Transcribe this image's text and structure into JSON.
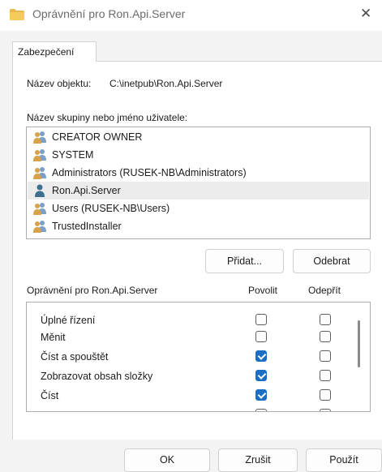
{
  "window": {
    "title": "Oprávnění pro Ron.Api.Server",
    "close_glyph": "✕"
  },
  "tab": {
    "label": "Zabezpečení"
  },
  "object": {
    "label": "Název objektu:",
    "value": "C:\\inetpub\\Ron.Api.Server"
  },
  "groups": {
    "label": "Název skupiny nebo jméno uživatele:",
    "items": [
      {
        "name": "CREATOR OWNER",
        "icon": "group-icon"
      },
      {
        "name": "SYSTEM",
        "icon": "group-icon"
      },
      {
        "name": "Administrators (RUSEK-NB\\Administrators)",
        "icon": "group-icon"
      },
      {
        "name": "Ron.Api.Server",
        "icon": "user-icon"
      },
      {
        "name": "Users (RUSEK-NB\\Users)",
        "icon": "group-icon"
      },
      {
        "name": "TrustedInstaller",
        "icon": "group-icon"
      }
    ],
    "selected_index": 3
  },
  "buttons": {
    "add": "Přidat...",
    "remove": "Odebrat",
    "ok": "OK",
    "cancel": "Zrušit",
    "apply": "Použít"
  },
  "permissions": {
    "label": "Oprávnění pro Ron.Api.Server",
    "allow_label": "Povolit",
    "deny_label": "Odepřít",
    "items": [
      {
        "name": "Úplné řízení",
        "allow": false,
        "deny": false
      },
      {
        "name": "Měnit",
        "allow": false,
        "deny": false
      },
      {
        "name": "Číst a spouštět",
        "allow": true,
        "deny": false
      },
      {
        "name": "Zobrazovat obsah složky",
        "allow": true,
        "deny": false
      },
      {
        "name": "Číst",
        "allow": true,
        "deny": false
      }
    ]
  },
  "colors": {
    "accent": "#1a6fc4",
    "folder": "#e8b84a",
    "selection": "#e5f1fb"
  }
}
